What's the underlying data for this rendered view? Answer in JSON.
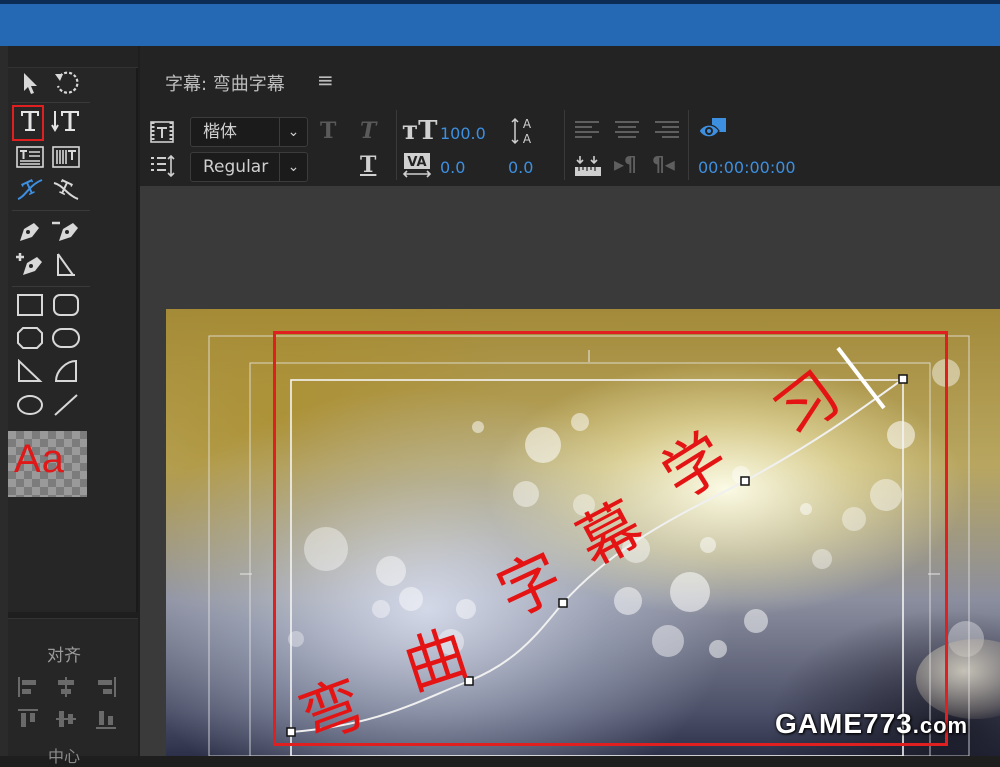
{
  "panel": {
    "title": "字幕: 弯曲字幕",
    "menu_icon": "≡"
  },
  "toolbar": {
    "font_family": "楷体",
    "font_style": "Regular",
    "font_size": "100.0",
    "kerning": "0.0",
    "leading": "0.0",
    "timecode": "00:00:00:00"
  },
  "tools": {
    "style_swatch_text": "Aa",
    "align_title": "对齐",
    "center_title": "中心"
  },
  "canvas": {
    "path_text": "弯曲字幕学习",
    "text_color": "#e51414"
  },
  "watermark": {
    "main": "GAME773",
    "suffix": ".com"
  },
  "colors": {
    "accent_blue": "#3d8fe0",
    "title_bar": "#2568b4",
    "highlight_red": "#e02020"
  }
}
